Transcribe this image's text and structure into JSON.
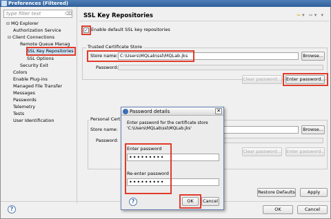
{
  "window": {
    "title": "Preferences (Filtered)"
  },
  "filter": {
    "placeholder": "type filter text",
    "clear_icon": "clear-icon"
  },
  "tree": {
    "items": [
      {
        "label": "MQ Explorer",
        "toggle": "⊟"
      },
      {
        "label": "Authorization Service",
        "toggle": ""
      },
      {
        "label": "Client Connections",
        "toggle": "⊟"
      },
      {
        "label": "Remote Queue Manag",
        "toggle": ""
      },
      {
        "label": "SSL Key Repositories",
        "toggle": "",
        "selected": true
      },
      {
        "label": "SSL Options",
        "toggle": ""
      },
      {
        "label": "Security Exit",
        "toggle": ""
      },
      {
        "label": "Colors",
        "toggle": ""
      },
      {
        "label": "Enable Plug-ins",
        "toggle": ""
      },
      {
        "label": "Managed File Transfer",
        "toggle": ""
      },
      {
        "label": "Messages",
        "toggle": ""
      },
      {
        "label": "Passwords",
        "toggle": ""
      },
      {
        "label": "Telemetry",
        "toggle": ""
      },
      {
        "label": "Tests",
        "toggle": ""
      },
      {
        "label": "User Identification",
        "toggle": ""
      }
    ]
  },
  "page": {
    "title": "SSL Key Repositories",
    "nav": {
      "back": "⇦",
      "back_menu": "▾",
      "forward": "⇨",
      "forward_menu": "▾",
      "menu": "▾"
    },
    "enable_default": {
      "label": "Enable default SSL key repositories",
      "checked": true
    },
    "trusted": {
      "group_title": "Trusted Certificate Store",
      "store_label": "Store name:",
      "store_value": "C:\\Users\\MQLab\\ssl\\MQLab.jks",
      "browse": "Browse...",
      "password_label": "Password:",
      "clear_password": "Clear password...",
      "enter_password": "Enter password..."
    },
    "personal": {
      "group_title": "Personal Certi",
      "store_label": "Store name:",
      "store_value": "",
      "browse": "Browse...",
      "password_label": "Password:",
      "clear_password": "Clear password...",
      "enter_password": "Enter password..."
    },
    "restore_defaults": "Restore Defaults",
    "apply": "Apply"
  },
  "footer": {
    "ok": "OK",
    "cancel": "Cancel",
    "help": "?"
  },
  "dialog": {
    "title": "Password details",
    "close": "✕",
    "message": "Enter password for the certificate store 'C:\\Users\\MQLab\\ssl\\MQLab.jks'",
    "enter_label": "Enter password",
    "enter_value": "•••••••••",
    "reenter_label": "Re-enter password",
    "reenter_value": "•••••••••",
    "help": "?",
    "ok": "OK",
    "cancel": "Cancel"
  },
  "colors": {
    "highlight": "#e13a2a",
    "title_blue": "#2f5f9a",
    "selection": "#cde3f8"
  }
}
